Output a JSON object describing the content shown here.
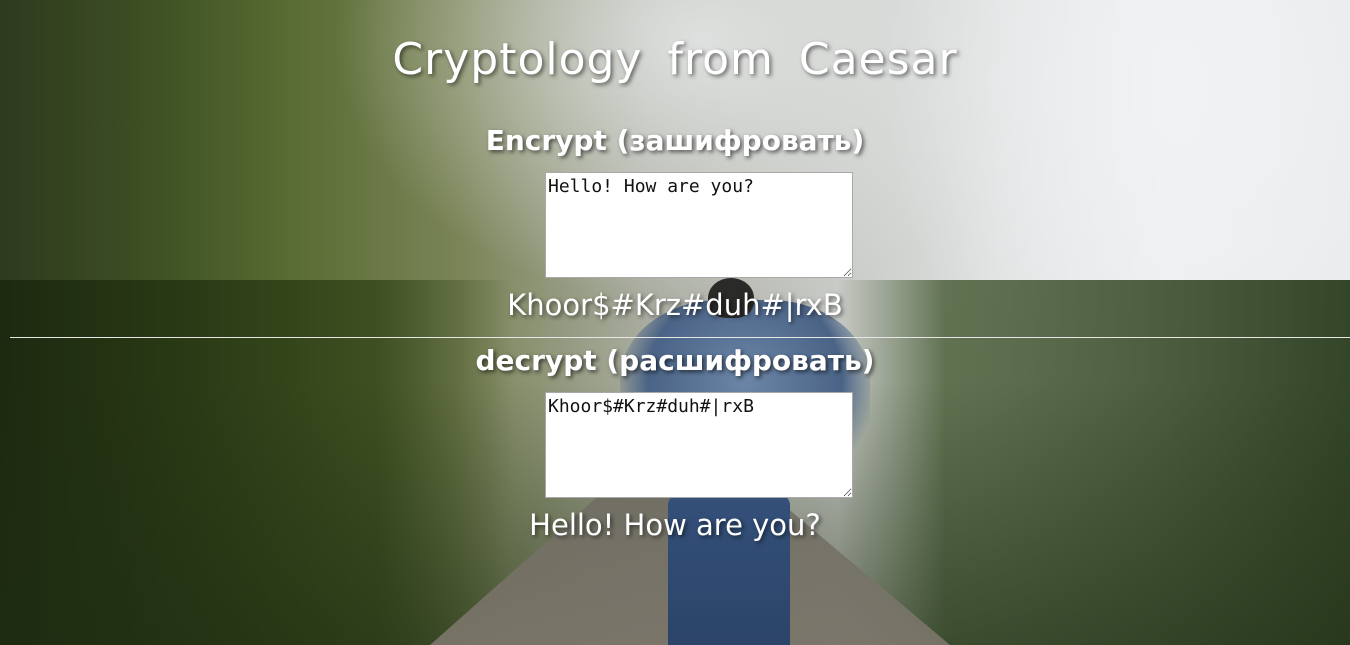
{
  "page": {
    "title": "Cryptology from Caesar"
  },
  "encrypt": {
    "heading": "Encrypt (зашифровать)",
    "input_value": "Hello! How are you?",
    "output": "Khoor$#Krz#duh#|rxB"
  },
  "decrypt": {
    "heading": "decrypt (расшифровать)",
    "input_value": "Khoor$#Krz#duh#|rxB",
    "output": "Hello! How are you?"
  },
  "colors": {
    "text": "#ffffff",
    "textbox_background": "#ffffff",
    "textbox_border": "#a9a9a9",
    "divider": "#e6e6e6"
  }
}
